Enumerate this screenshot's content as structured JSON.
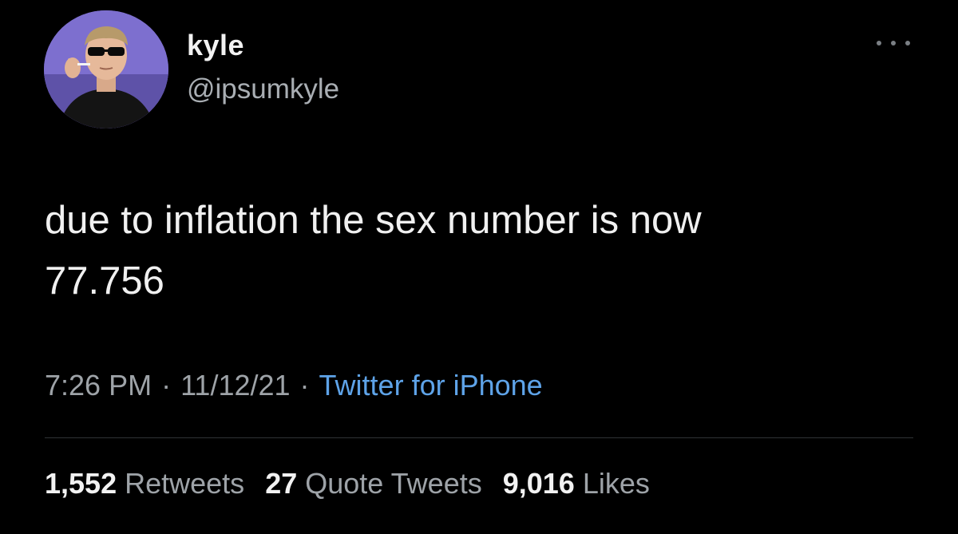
{
  "author": {
    "display_name": "kyle",
    "handle": "@ipsumkyle",
    "avatar_icon": "profile-photo"
  },
  "tweet": {
    "text_line1": "due to inflation the sex number is now",
    "text_line2": "77.756"
  },
  "meta": {
    "time": "7:26 PM",
    "separator": "·",
    "date": "11/12/21",
    "source": "Twitter for iPhone"
  },
  "stats": {
    "retweets_count": "1,552",
    "retweets_label": "Retweets",
    "quotes_count": "27",
    "quotes_label": "Quote Tweets",
    "likes_count": "9,016",
    "likes_label": "Likes"
  },
  "menu": {
    "icon": "more-horizontal-icon"
  },
  "colors": {
    "background": "#000000",
    "text": "#f0f0f0",
    "muted": "#9ea3a8",
    "link": "#5ea3e8"
  }
}
